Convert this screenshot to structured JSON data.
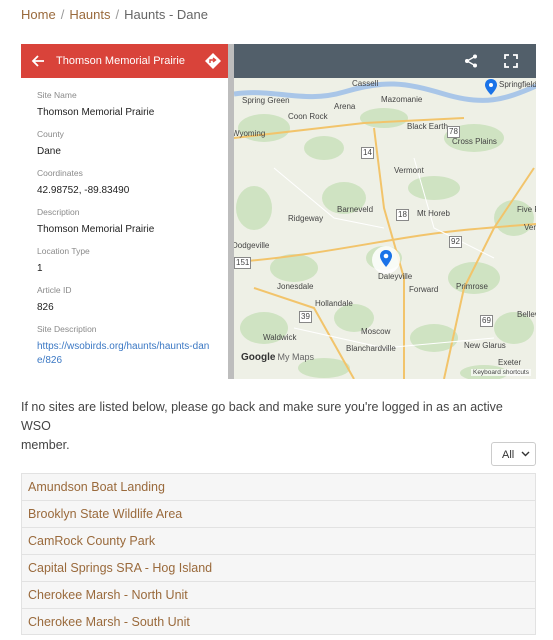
{
  "breadcrumb": {
    "home": "Home",
    "haunts": "Haunts",
    "current": "Haunts - Dane"
  },
  "map_panel": {
    "title": "Thomson Memorial Prairie",
    "fields": [
      {
        "label": "Site Name",
        "value": "Thomson Memorial Prairie"
      },
      {
        "label": "County",
        "value": "Dane"
      },
      {
        "label": "Coordinates",
        "value": "42.98752, -89.83490"
      },
      {
        "label": "Description",
        "value": "Thomson Memorial Prairie"
      },
      {
        "label": "Location Type",
        "value": "1"
      },
      {
        "label": "Article ID",
        "value": "826"
      },
      {
        "label": "Site Description",
        "value": "https://wsobirds.org/haunts/haunts-dane/826"
      }
    ],
    "toolbar_icons": [
      "share-icon",
      "fullscreen-icon"
    ]
  },
  "map": {
    "places": [
      "Cassell",
      "Springfield Corners",
      "Spring Green",
      "Arena",
      "Mazomanie",
      "Coon Rock",
      "Black Earth",
      "Wyoming",
      "Cross Plains",
      "Vermont",
      "Barneveld",
      "Mt Horeb",
      "Five Pi",
      "Ridgeway",
      "Verona",
      "Dodgeville",
      "Daleyville",
      "Jonesdale",
      "Forward",
      "Primrose",
      "Hollandale",
      "Belleville",
      "Waldwick",
      "Moscow",
      "Blanchardville",
      "New Glarus",
      "Exeter"
    ],
    "route_numbers": [
      "14",
      "78",
      "18",
      "92",
      "39",
      "151",
      "69"
    ],
    "attribution_google": "Google",
    "attribution_mymaps": "My Maps",
    "keyboard_shortcuts": "Keyboard shortcuts",
    "colors": {
      "marker": "#1a73e8",
      "panel_header": "#d9433a",
      "toolbar": "#525f6a"
    }
  },
  "notice_lines": [
    "If no sites are listed below, please go back and make sure you're logged in as an active WSO",
    "member."
  ],
  "filter": {
    "selected": "All"
  },
  "sites": [
    "Amundson Boat Landing",
    "Brooklyn State Wildlife Area",
    "CamRock County Park",
    "Capital Springs SRA - Hog Island",
    "Cherokee Marsh - North Unit",
    "Cherokee Marsh - South Unit"
  ]
}
